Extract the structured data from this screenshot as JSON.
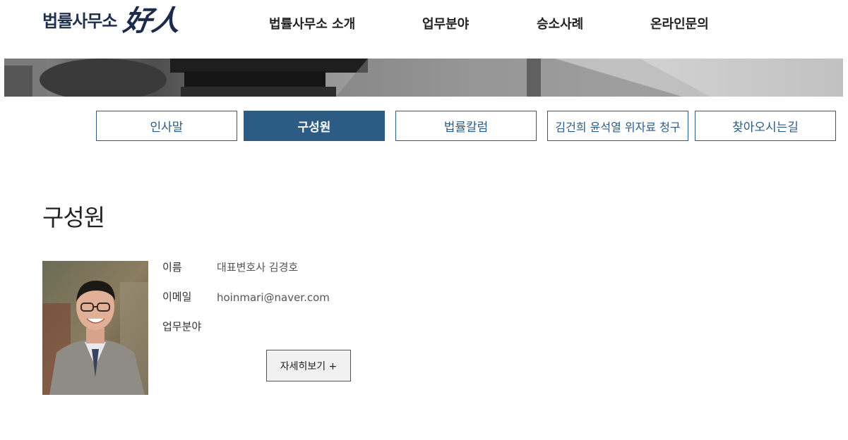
{
  "header": {
    "logo_text": "법률사무소",
    "logo_hanja": "好人",
    "nav": [
      {
        "label": "법률사무소 소개"
      },
      {
        "label": "업무분야"
      },
      {
        "label": "승소사례"
      },
      {
        "label": "온라인문의"
      }
    ]
  },
  "tabs": [
    {
      "label": "인사말",
      "active": false
    },
    {
      "label": "구성원",
      "active": true
    },
    {
      "label": "법률칼럼",
      "active": false
    },
    {
      "label": "김건희 윤석열 위자료 청구",
      "active": false
    },
    {
      "label": "찾아오시는길",
      "active": false
    }
  ],
  "main": {
    "title": "구성원",
    "member": {
      "name_label": "이름",
      "name_value": "대표변호사 김경호",
      "email_label": "이메일",
      "email_value": "hoinmari@naver.com",
      "field_label": "업무분야",
      "more_button": "자세히보기 +"
    }
  },
  "colors": {
    "accent": "#2c5b84",
    "logo": "#1f2f4e"
  }
}
